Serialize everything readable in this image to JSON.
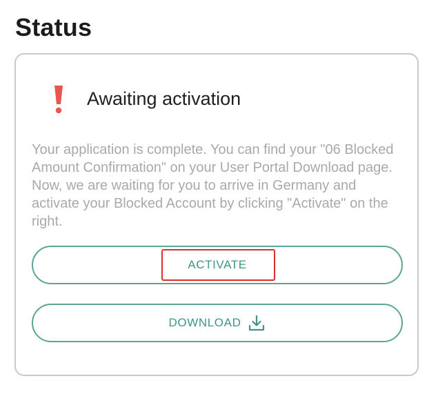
{
  "page": {
    "title": "Status"
  },
  "status_card": {
    "icon": "exclamation-icon",
    "icon_color": "#e8574f",
    "heading": "Awaiting activation",
    "description": "Your application is complete. You can find your \"06 Blocked Amount Confirmation\" on your User Portal Download page. Now, we are waiting for you to arrive in Germany and activate your Blocked Account by clicking \"Activate\" on the right."
  },
  "buttons": {
    "activate_label": "ACTIVATE",
    "download_label": "DOWNLOAD",
    "download_icon": "download-icon",
    "accent_color": "#3e9585"
  },
  "highlight": {
    "color": "#d9302c",
    "target": "activate-button"
  }
}
